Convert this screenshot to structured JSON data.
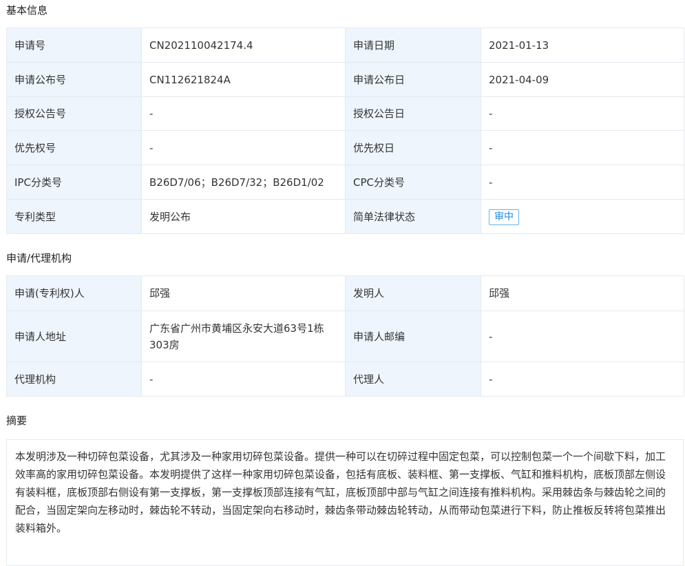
{
  "basic": {
    "title": "基本信息",
    "rows": [
      {
        "l1": "申请号",
        "v1": "CN202110042174.4",
        "l2": "申请日期",
        "v2": "2021-01-13"
      },
      {
        "l1": "申请公布号",
        "v1": "CN112621824A",
        "l2": "申请公布日",
        "v2": "2021-04-09"
      },
      {
        "l1": "授权公告号",
        "v1": "-",
        "l2": "授权公告日",
        "v2": "-"
      },
      {
        "l1": "优先权号",
        "v1": "-",
        "l2": "优先权日",
        "v2": "-"
      },
      {
        "l1": "IPC分类号",
        "v1": "B26D7/06；B26D7/32；B26D1/02",
        "l2": "CPC分类号",
        "v2": "-"
      },
      {
        "l1": "专利类型",
        "v1": "发明公布",
        "l2": "简单法律状态",
        "v2": "审中"
      }
    ]
  },
  "agency": {
    "title": "申请/代理机构",
    "rows": [
      {
        "l1": "申请(专利权)人",
        "v1": "邱强",
        "l2": "发明人",
        "v2": "邱强"
      },
      {
        "l1": "申请人地址",
        "v1": "广东省广州市黄埔区永安大道63号1栋303房",
        "l2": "申请人邮编",
        "v2": "-"
      },
      {
        "l1": "代理机构",
        "v1": "-",
        "l2": "代理人",
        "v2": "-"
      }
    ]
  },
  "abstract": {
    "title": "摘要",
    "text": "本发明涉及一种切碎包菜设备，尤其涉及一种家用切碎包菜设备。提供一种可以在切碎过程中固定包菜，可以控制包菜一个一个间歇下料，加工效率高的家用切碎包菜设备。本发明提供了这样一种家用切碎包菜设备，包括有底板、装料框、第一支撑板、气缸和推料机构，底板顶部左侧设有装料框，底板顶部右侧设有第一支撑板，第一支撑板顶部连接有气缸，底板顶部中部与气缸之间连接有推料机构。采用棘齿条与棘齿轮之间的配合，当固定架向左移动时，棘齿轮不转动，当固定架向右移动时，棘齿条带动棘齿轮转动，从而带动包菜进行下料，防止推板反转将包菜推出装料箱外。"
  }
}
